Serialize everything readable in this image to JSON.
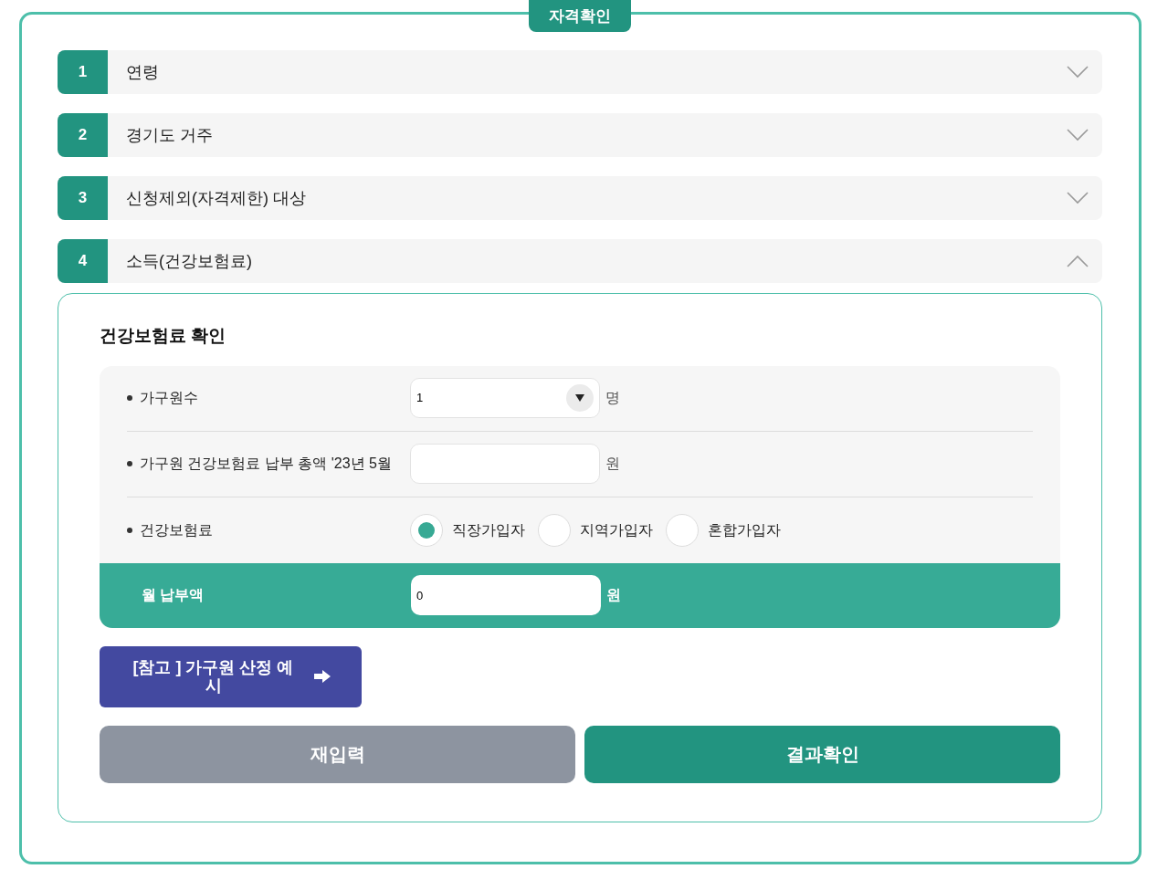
{
  "title": "자격확인",
  "steps": [
    {
      "number": "1",
      "label": "연령",
      "expanded": false
    },
    {
      "number": "2",
      "label": "경기도 거주",
      "expanded": false
    },
    {
      "number": "3",
      "label": "신청제외(자격제한) 대상",
      "expanded": false
    },
    {
      "number": "4",
      "label": "소득(건강보험료)",
      "expanded": true
    }
  ],
  "panel": {
    "heading": "건강보험료 확인",
    "rows": [
      {
        "kind": "select",
        "label": "가구원수",
        "value": "1",
        "unit": "명"
      },
      {
        "kind": "input",
        "label": "가구원 건강보험료 납부 총액 '23년 5월",
        "unit": "원"
      },
      {
        "kind": "radio",
        "label": "건강보험료",
        "options": [
          {
            "label": "직장가입자",
            "selected": true
          },
          {
            "label": "지역가입자",
            "selected": false
          },
          {
            "label": "혼합가입자",
            "selected": false
          }
        ]
      }
    ],
    "total": {
      "label": "월 납부액",
      "value": "0",
      "unit": "원"
    },
    "reference_button": {
      "label": "[참고 ] 가구원 산정 예시"
    },
    "buttons": [
      {
        "kind": "reset",
        "label": "재입력"
      },
      {
        "kind": "submit",
        "label": "결과확인"
      }
    ]
  }
}
